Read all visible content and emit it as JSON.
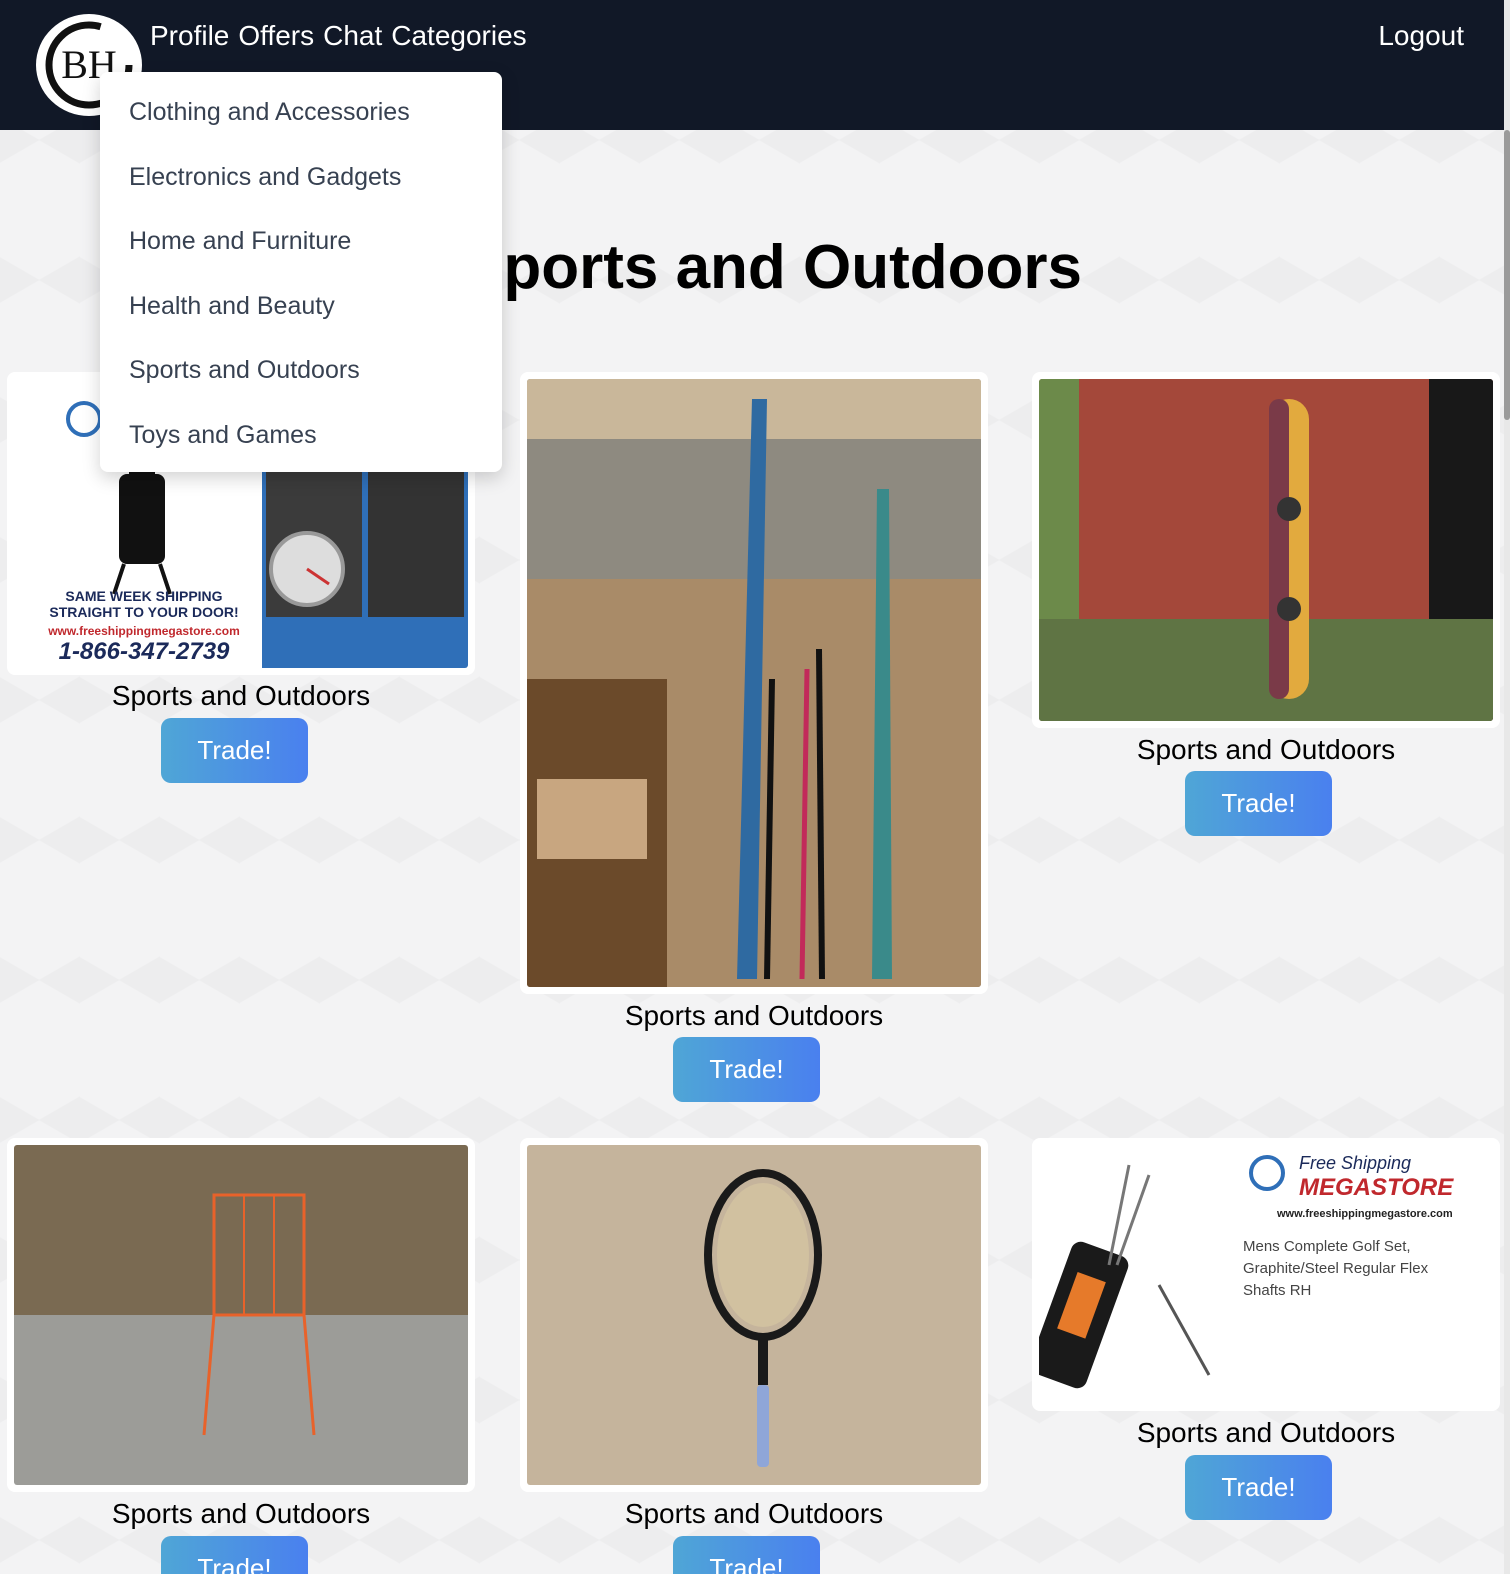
{
  "navbar": {
    "logo_text": "BH",
    "links": [
      "Profile",
      "Offers",
      "Chat",
      "Categories"
    ],
    "logout_label": "Logout"
  },
  "categories_menu": [
    "Clothing and Accessories",
    "Electronics and Gadgets",
    "Home and Furniture",
    "Health and Beauty",
    "Sports and Outdoors",
    "Toys and Games"
  ],
  "page_title": "Sports and Outdoors",
  "listings": [
    {
      "category": "Sports and Outdoors",
      "button": "Trade!",
      "image": "smoker-grill-ad",
      "ad_text": {
        "line1": "SAME WEEK SHIPPING",
        "line2": "STRAIGHT TO YOUR DOOR!",
        "site": "www.freeshippingmegastore.com",
        "phone": "1-866-347-2739"
      }
    },
    {
      "category": "Sports and Outdoors",
      "button": "Trade!",
      "image": "skis-and-poles"
    },
    {
      "category": "Sports and Outdoors",
      "button": "Trade!",
      "image": "snowboard-against-brick-wall"
    },
    {
      "category": "Sports and Outdoors",
      "button": "Trade!",
      "image": "orange-ball-basket"
    },
    {
      "category": "Sports and Outdoors",
      "button": "Trade!",
      "image": "tennis-racket"
    },
    {
      "category": "Sports and Outdoors",
      "button": "Trade!",
      "image": "golf-set-ad",
      "ad_text": {
        "brand1": "Free Shipping",
        "brand2": "MEGASTORE",
        "site": "www.freeshippingmegastore.com",
        "desc1": "Mens Complete Golf Set,",
        "desc2": "Graphite/Steel Regular Flex",
        "desc3": "Shafts RH"
      }
    }
  ]
}
